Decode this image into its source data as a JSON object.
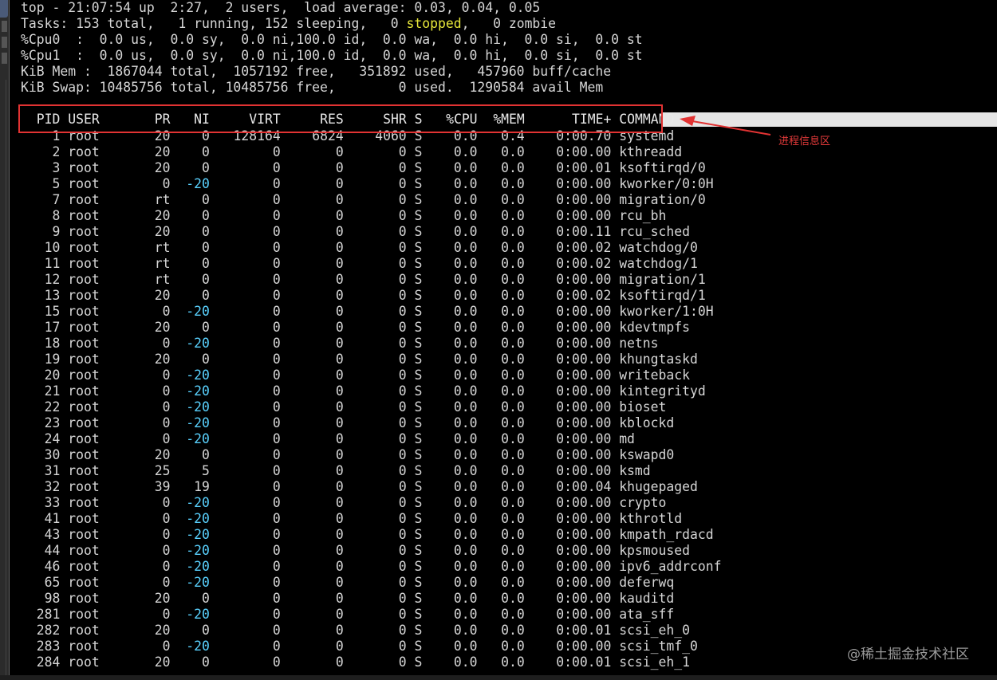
{
  "summary": {
    "l1": "top - 21:07:54 up  2:27,  2 users,  load average: 0.03, 0.04, 0.05",
    "l2_pre": "Tasks: 153 total,   1 running, 152 sleeping,   0 ",
    "l2_stopped": "stopped",
    "l2_post": ",   0 zombie",
    "l3": "%Cpu0  :  0.0 us,  0.0 sy,  0.0 ni,100.0 id,  0.0 wa,  0.0 hi,  0.0 si,  0.0 st",
    "l4": "%Cpu1  :  0.0 us,  0.0 sy,  0.0 ni,100.0 id,  0.0 wa,  0.0 hi,  0.0 si,  0.0 st",
    "l5": "KiB Mem :  1867044 total,  1057192 free,   351892 used,   457960 buff/cache",
    "l6": "KiB Swap: 10485756 total, 10485756 free,        0 used.  1290584 avail Mem"
  },
  "columns": [
    "PID",
    "USER",
    "PR",
    "NI",
    "VIRT",
    "RES",
    "SHR",
    "S",
    "%CPU",
    "%MEM",
    "TIME+",
    "COMMAND"
  ],
  "processes": [
    [
      "1",
      "root",
      "20",
      "0",
      "128164",
      "6824",
      "4060",
      "S",
      "0.0",
      "0.4",
      "0:00.70",
      "systemd"
    ],
    [
      "2",
      "root",
      "20",
      "0",
      "0",
      "0",
      "0",
      "S",
      "0.0",
      "0.0",
      "0:00.00",
      "kthreadd"
    ],
    [
      "3",
      "root",
      "20",
      "0",
      "0",
      "0",
      "0",
      "S",
      "0.0",
      "0.0",
      "0:00.01",
      "ksoftirqd/0"
    ],
    [
      "5",
      "root",
      "0",
      "-20",
      "0",
      "0",
      "0",
      "S",
      "0.0",
      "0.0",
      "0:00.00",
      "kworker/0:0H"
    ],
    [
      "7",
      "root",
      "rt",
      "0",
      "0",
      "0",
      "0",
      "S",
      "0.0",
      "0.0",
      "0:00.00",
      "migration/0"
    ],
    [
      "8",
      "root",
      "20",
      "0",
      "0",
      "0",
      "0",
      "S",
      "0.0",
      "0.0",
      "0:00.00",
      "rcu_bh"
    ],
    [
      "9",
      "root",
      "20",
      "0",
      "0",
      "0",
      "0",
      "S",
      "0.0",
      "0.0",
      "0:00.11",
      "rcu_sched"
    ],
    [
      "10",
      "root",
      "rt",
      "0",
      "0",
      "0",
      "0",
      "S",
      "0.0",
      "0.0",
      "0:00.02",
      "watchdog/0"
    ],
    [
      "11",
      "root",
      "rt",
      "0",
      "0",
      "0",
      "0",
      "S",
      "0.0",
      "0.0",
      "0:00.02",
      "watchdog/1"
    ],
    [
      "12",
      "root",
      "rt",
      "0",
      "0",
      "0",
      "0",
      "S",
      "0.0",
      "0.0",
      "0:00.00",
      "migration/1"
    ],
    [
      "13",
      "root",
      "20",
      "0",
      "0",
      "0",
      "0",
      "S",
      "0.0",
      "0.0",
      "0:00.02",
      "ksoftirqd/1"
    ],
    [
      "15",
      "root",
      "0",
      "-20",
      "0",
      "0",
      "0",
      "S",
      "0.0",
      "0.0",
      "0:00.00",
      "kworker/1:0H"
    ],
    [
      "17",
      "root",
      "20",
      "0",
      "0",
      "0",
      "0",
      "S",
      "0.0",
      "0.0",
      "0:00.00",
      "kdevtmpfs"
    ],
    [
      "18",
      "root",
      "0",
      "-20",
      "0",
      "0",
      "0",
      "S",
      "0.0",
      "0.0",
      "0:00.00",
      "netns"
    ],
    [
      "19",
      "root",
      "20",
      "0",
      "0",
      "0",
      "0",
      "S",
      "0.0",
      "0.0",
      "0:00.00",
      "khungtaskd"
    ],
    [
      "20",
      "root",
      "0",
      "-20",
      "0",
      "0",
      "0",
      "S",
      "0.0",
      "0.0",
      "0:00.00",
      "writeback"
    ],
    [
      "21",
      "root",
      "0",
      "-20",
      "0",
      "0",
      "0",
      "S",
      "0.0",
      "0.0",
      "0:00.00",
      "kintegrityd"
    ],
    [
      "22",
      "root",
      "0",
      "-20",
      "0",
      "0",
      "0",
      "S",
      "0.0",
      "0.0",
      "0:00.00",
      "bioset"
    ],
    [
      "23",
      "root",
      "0",
      "-20",
      "0",
      "0",
      "0",
      "S",
      "0.0",
      "0.0",
      "0:00.00",
      "kblockd"
    ],
    [
      "24",
      "root",
      "0",
      "-20",
      "0",
      "0",
      "0",
      "S",
      "0.0",
      "0.0",
      "0:00.00",
      "md"
    ],
    [
      "30",
      "root",
      "20",
      "0",
      "0",
      "0",
      "0",
      "S",
      "0.0",
      "0.0",
      "0:00.00",
      "kswapd0"
    ],
    [
      "31",
      "root",
      "25",
      "5",
      "0",
      "0",
      "0",
      "S",
      "0.0",
      "0.0",
      "0:00.00",
      "ksmd"
    ],
    [
      "32",
      "root",
      "39",
      "19",
      "0",
      "0",
      "0",
      "S",
      "0.0",
      "0.0",
      "0:00.04",
      "khugepaged"
    ],
    [
      "33",
      "root",
      "0",
      "-20",
      "0",
      "0",
      "0",
      "S",
      "0.0",
      "0.0",
      "0:00.00",
      "crypto"
    ],
    [
      "41",
      "root",
      "0",
      "-20",
      "0",
      "0",
      "0",
      "S",
      "0.0",
      "0.0",
      "0:00.00",
      "kthrotld"
    ],
    [
      "43",
      "root",
      "0",
      "-20",
      "0",
      "0",
      "0",
      "S",
      "0.0",
      "0.0",
      "0:00.00",
      "kmpath_rdacd"
    ],
    [
      "44",
      "root",
      "0",
      "-20",
      "0",
      "0",
      "0",
      "S",
      "0.0",
      "0.0",
      "0:00.00",
      "kpsmoused"
    ],
    [
      "46",
      "root",
      "0",
      "-20",
      "0",
      "0",
      "0",
      "S",
      "0.0",
      "0.0",
      "0:00.00",
      "ipv6_addrconf"
    ],
    [
      "65",
      "root",
      "0",
      "-20",
      "0",
      "0",
      "0",
      "S",
      "0.0",
      "0.0",
      "0:00.00",
      "deferwq"
    ],
    [
      "98",
      "root",
      "20",
      "0",
      "0",
      "0",
      "0",
      "S",
      "0.0",
      "0.0",
      "0:00.00",
      "kauditd"
    ],
    [
      "281",
      "root",
      "0",
      "-20",
      "0",
      "0",
      "0",
      "S",
      "0.0",
      "0.0",
      "0:00.00",
      "ata_sff"
    ],
    [
      "282",
      "root",
      "20",
      "0",
      "0",
      "0",
      "0",
      "S",
      "0.0",
      "0.0",
      "0:00.01",
      "scsi_eh_0"
    ],
    [
      "283",
      "root",
      "0",
      "-20",
      "0",
      "0",
      "0",
      "S",
      "0.0",
      "0.0",
      "0:00.00",
      "scsi_tmf_0"
    ],
    [
      "284",
      "root",
      "20",
      "0",
      "0",
      "0",
      "0",
      "S",
      "0.0",
      "0.0",
      "0:00.01",
      "scsi_eh_1"
    ]
  ],
  "annotation": {
    "label": "进程信息区",
    "color": "#e23333"
  },
  "watermark": "@稀土掘金技术社区",
  "colors": {
    "background": "#000000",
    "text": "#d6d6d6",
    "stopped": "#e8e83a",
    "negative_nice": "#5ad2ff",
    "header_bar": "#e6e6e6"
  }
}
